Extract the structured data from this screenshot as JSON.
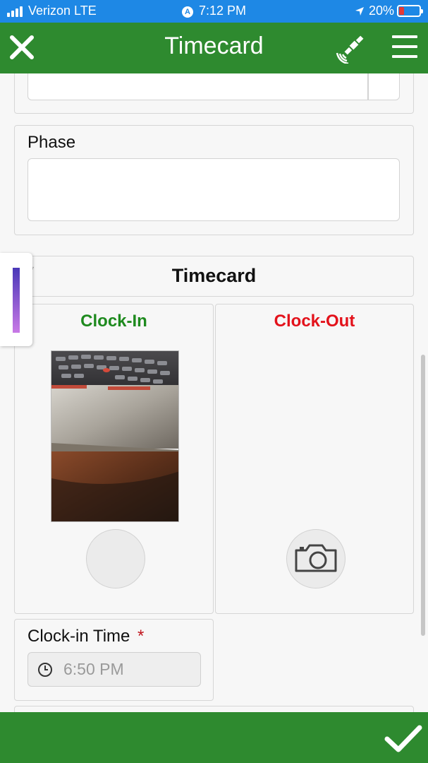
{
  "status_bar": {
    "carrier": "Verizon LTE",
    "time": "7:12 PM",
    "nav_icon": "A",
    "battery": "20%",
    "battery_level": 0.2
  },
  "header": {
    "title": "Timecard",
    "close_icon": "close-icon",
    "satellite_icon": "satellite-icon",
    "menu_icon": "hamburger-menu-icon"
  },
  "form": {
    "phase_label": "Phase",
    "phase_value": "",
    "section_title": "Timecard",
    "clock_in_label": "Clock-In",
    "clock_in_color": "#1e8a1e",
    "clock_out_label": "Clock-Out",
    "clock_out_color": "#e3121b",
    "clock_in_time_label": "Clock-in Time",
    "required_marker": "*",
    "clock_in_time_value": "6:50 PM"
  },
  "footer": {
    "confirm_icon": "checkmark-icon"
  },
  "colors": {
    "header_green": "#2e8a2f",
    "status_blue": "#1e88e5"
  }
}
